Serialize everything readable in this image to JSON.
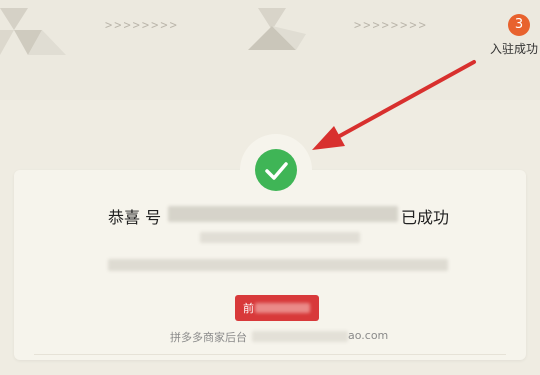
{
  "progress": {
    "current_step_number": "3",
    "current_step_label": "入驻成功",
    "separator": ">>>>>>>>"
  },
  "result": {
    "title_prefix": "恭喜 号",
    "title_suffix": "已成功"
  },
  "action_button": {
    "label": "前"
  },
  "footer": {
    "prefix": "拼多多商家后台",
    "suffix": "ao.com"
  },
  "annotation": {
    "arrow_color": "#d8302e"
  },
  "colors": {
    "success_green": "#3fb556",
    "button_red": "#d8393a",
    "step_orange": "#e8622e"
  }
}
